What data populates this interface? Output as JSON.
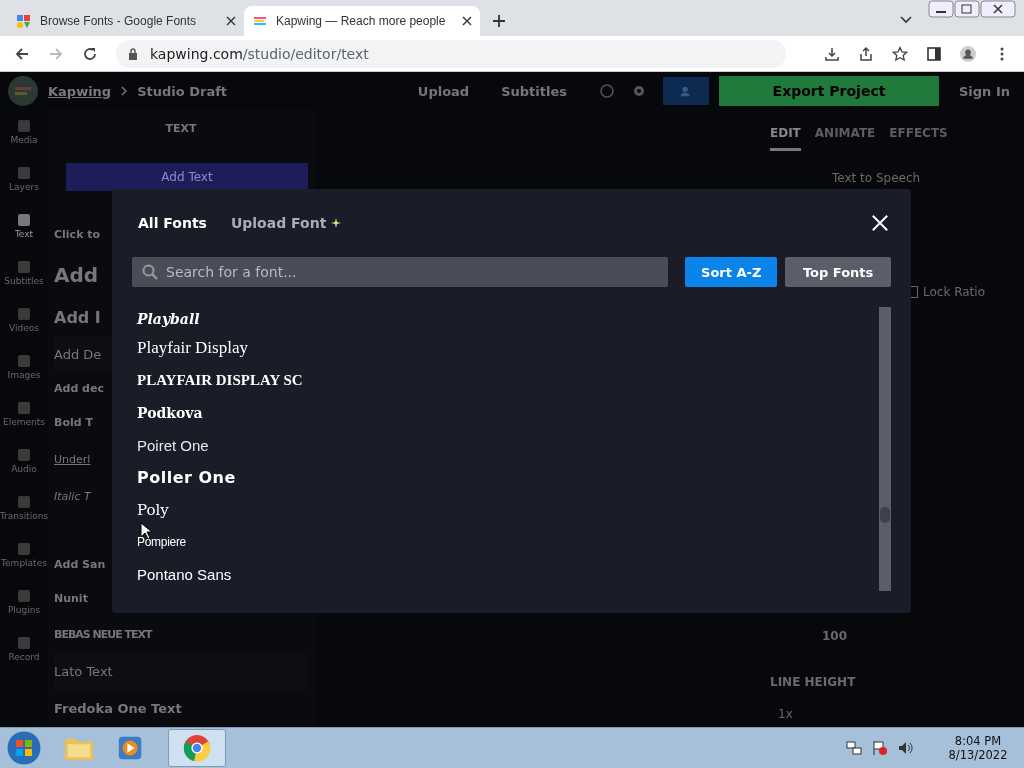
{
  "browser": {
    "tabs": [
      {
        "title": "Browse Fonts - Google Fonts",
        "selected": false
      },
      {
        "title": "Kapwing — Reach more people",
        "selected": true
      }
    ],
    "url_host": "kapwing.com",
    "url_path": "/studio/editor/text"
  },
  "header": {
    "brand": "Kapwing",
    "project": "Studio Draft",
    "actions": [
      "Upload",
      "Subtitles"
    ],
    "export": "Export Project",
    "sign_in": "Sign In"
  },
  "rail": [
    {
      "label": "Media",
      "selected": false
    },
    {
      "label": "Layers",
      "selected": false
    },
    {
      "label": "Text",
      "selected": true
    },
    {
      "label": "Subtitles",
      "selected": false
    },
    {
      "label": "Videos",
      "selected": false
    },
    {
      "label": "Images",
      "selected": false
    },
    {
      "label": "Elements",
      "selected": false
    },
    {
      "label": "Audio",
      "selected": false
    },
    {
      "label": "Transitions",
      "selected": false
    },
    {
      "label": "Templates",
      "selected": false
    },
    {
      "label": "Plugins",
      "selected": false
    },
    {
      "label": "Record",
      "selected": false
    }
  ],
  "text_panel": {
    "title": "TEXT",
    "add_button": "Add Text",
    "items": [
      {
        "kind": "hint",
        "text": "Click to"
      },
      {
        "kind": "big",
        "text": "Add"
      },
      {
        "kind": "medium",
        "text": "Add I"
      },
      {
        "kind": "card",
        "text": "Add De"
      },
      {
        "kind": "hint",
        "text": "Add dec"
      },
      {
        "kind": "bold",
        "text": "Bold T"
      },
      {
        "kind": "underline",
        "text": "Underl"
      },
      {
        "kind": "italic",
        "text": "Italic T"
      },
      {
        "kind": "hint",
        "text": "Add San"
      },
      {
        "kind": "bold",
        "text": "Nunit"
      },
      {
        "kind": "condensed",
        "text": "BEBAS NEUE TEXT"
      },
      {
        "kind": "card",
        "text": "Lato Text"
      },
      {
        "kind": "heavy",
        "text": "Fredoka One Text"
      }
    ]
  },
  "right_panel": {
    "tabs": [
      {
        "label": "EDIT",
        "selected": true
      },
      {
        "label": "ANIMATE",
        "selected": false
      },
      {
        "label": "EFFECTS",
        "selected": false
      }
    ],
    "tts": "Text to Speech",
    "lock_ratio": "Lock Ratio",
    "lock_ratio_checked": false,
    "size": "100",
    "line_height_label": "LINE HEIGHT",
    "line_height": "1x"
  },
  "modal": {
    "tabs": [
      {
        "label": "All Fonts",
        "selected": true
      },
      {
        "label": "Upload Font",
        "selected": false
      }
    ],
    "search_placeholder": "Search for a font...",
    "sort_buttons": [
      {
        "label": "Sort A-Z",
        "selected": true
      },
      {
        "label": "Top Fonts",
        "selected": false
      }
    ],
    "fonts": [
      {
        "name": "Playball",
        "kind": "script"
      },
      {
        "name": "Playfair Display",
        "kind": "serif"
      },
      {
        "name": "PLAYFAIR DISPLAY SC",
        "kind": "serif-bold"
      },
      {
        "name": "Podkova",
        "kind": "slab"
      },
      {
        "name": "Poiret One",
        "kind": "thin"
      },
      {
        "name": "Poller One",
        "kind": "heavy"
      },
      {
        "name": "Poly",
        "kind": "serif-medium"
      },
      {
        "name": "Pompiere",
        "kind": "condensed"
      },
      {
        "name": "Pontano Sans",
        "kind": "sans"
      }
    ]
  },
  "taskbar": {
    "time": "8:04 PM",
    "date": "8/13/2022"
  }
}
